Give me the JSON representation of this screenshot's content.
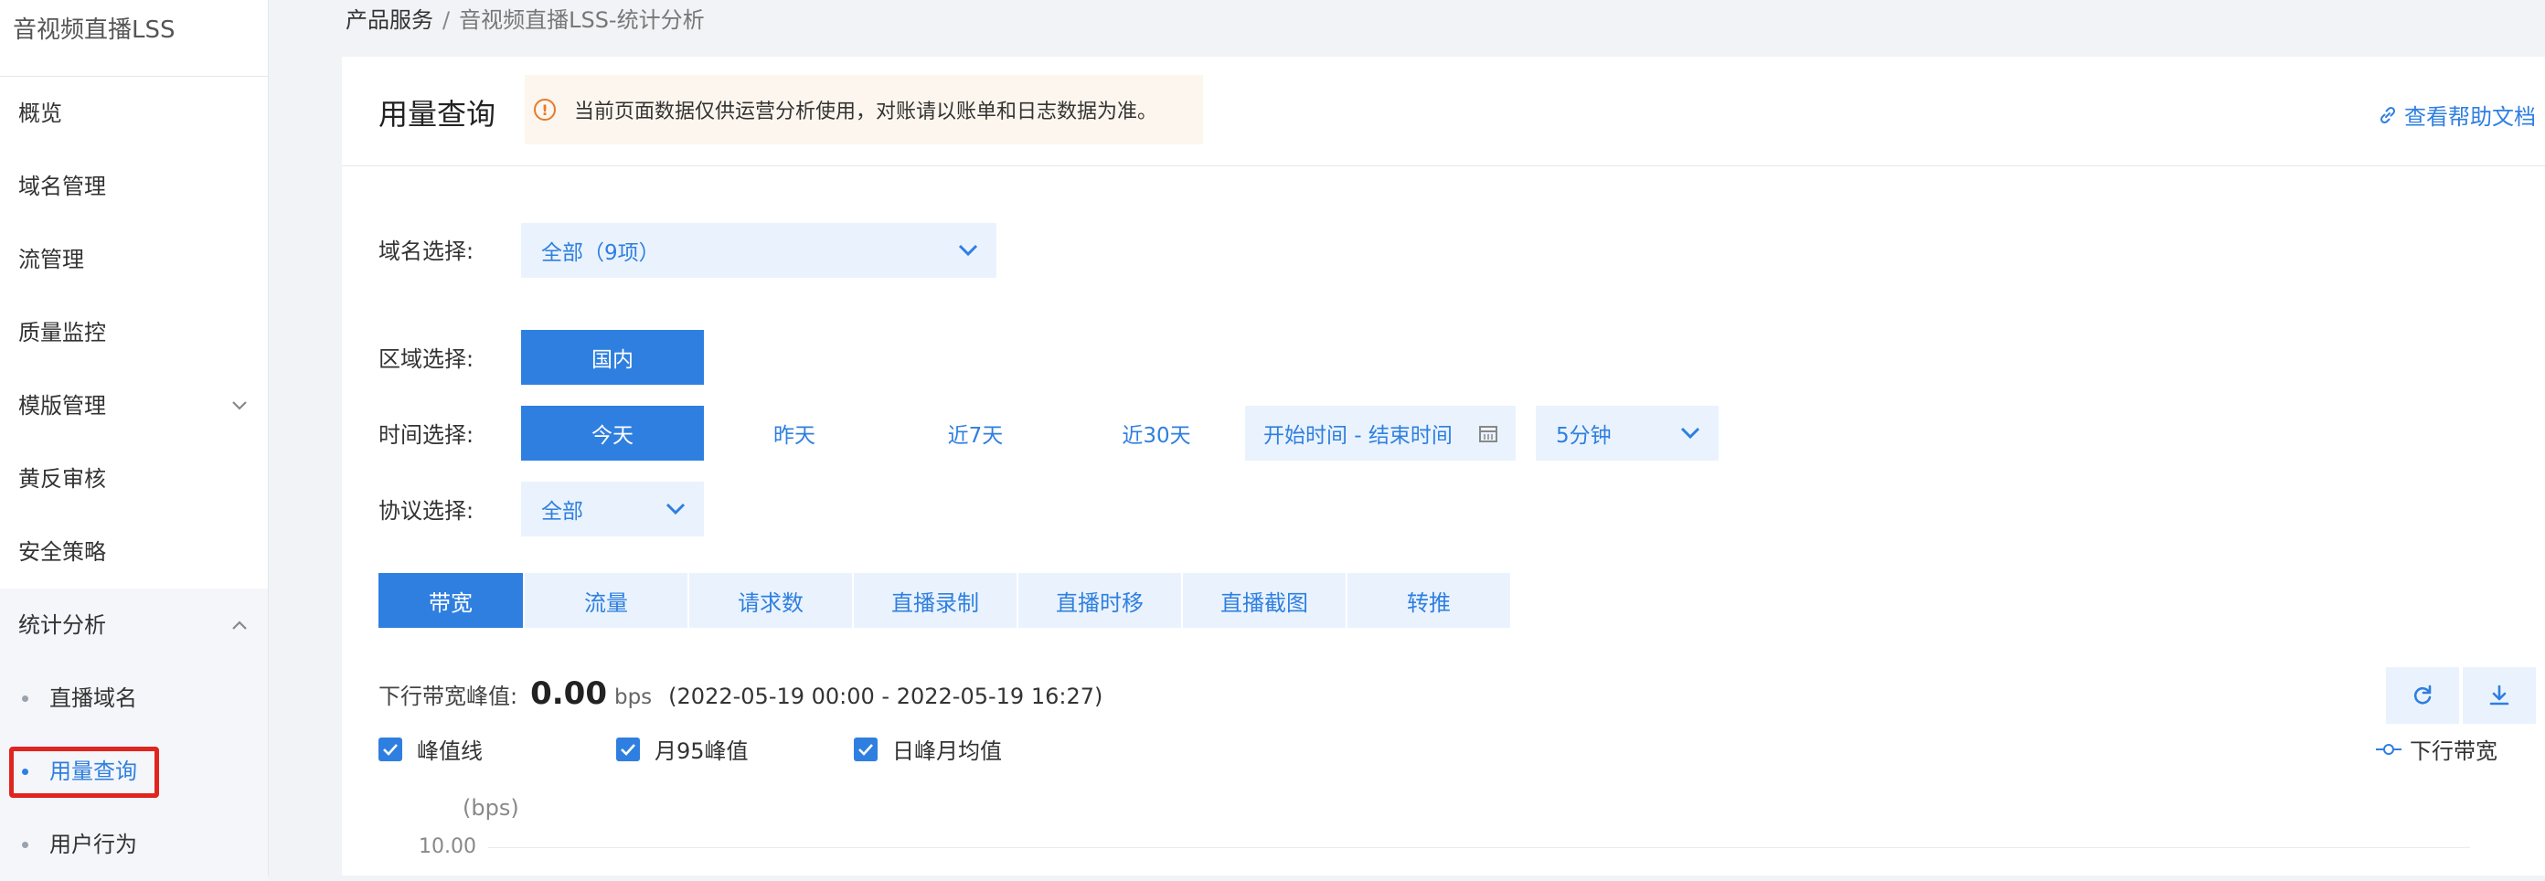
{
  "sidebar": {
    "title": "音视频直播LSS",
    "items": [
      {
        "label": "概览"
      },
      {
        "label": "域名管理"
      },
      {
        "label": "流管理"
      },
      {
        "label": "质量监控"
      },
      {
        "label": "模版管理"
      },
      {
        "label": "黄反审核"
      },
      {
        "label": "安全策略"
      }
    ],
    "group": {
      "label": "统计分析",
      "children": [
        {
          "label": "直播域名"
        },
        {
          "label": "用量查询"
        },
        {
          "label": "用户行为"
        }
      ]
    }
  },
  "breadcrumb": {
    "parent": "产品服务",
    "separator": "/",
    "current": "音视频直播LSS-统计分析"
  },
  "page": {
    "title": "用量查询",
    "notice": "当前页面数据仅供运营分析使用，对账请以账单和日志数据为准。",
    "help_link": "查看帮助文档"
  },
  "filters": {
    "domain": {
      "label": "域名选择:",
      "value": "全部（9项）"
    },
    "region": {
      "label": "区域选择:",
      "option": "国内"
    },
    "time": {
      "label": "时间选择:",
      "options": [
        "今天",
        "昨天",
        "近7天",
        "近30天"
      ],
      "range_placeholder": "开始时间 - 结束时间",
      "interval": "5分钟"
    },
    "protocol": {
      "label": "协议选择:",
      "value": "全部"
    }
  },
  "tabs": [
    "带宽",
    "流量",
    "请求数",
    "直播录制",
    "直播时移",
    "直播截图",
    "转推"
  ],
  "stats": {
    "peak_label": "下行带宽峰值:",
    "peak_value": "0.00",
    "peak_unit": "bps",
    "range": "(2022-05-19 00:00 - 2022-05-19 16:27)"
  },
  "checkboxes": [
    "峰值线",
    "月95峰值",
    "日峰月均值"
  ],
  "legend": "下行带宽",
  "chart": {
    "y_unit": "(bps)",
    "y_tick_top": "10.00"
  },
  "colors": {
    "accent": "#2f7fe0",
    "accent_light": "#eaf3fd",
    "warning": "#e57a2b",
    "highlight_border": "#e0251f"
  }
}
